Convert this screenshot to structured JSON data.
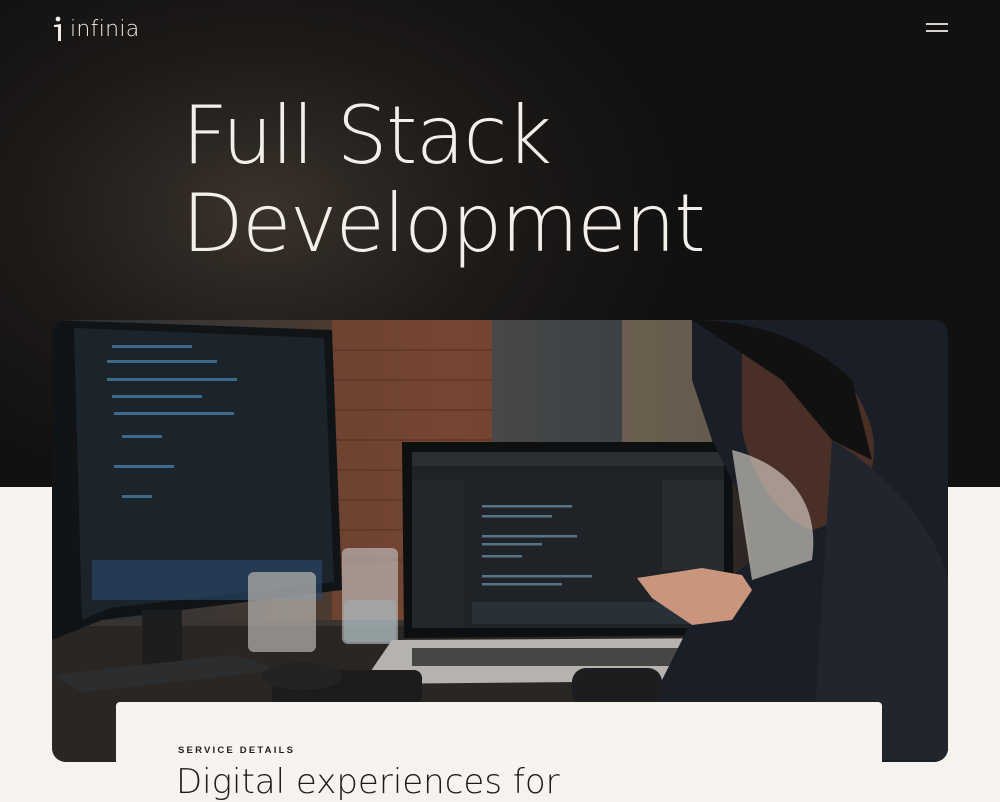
{
  "header": {
    "logo_text": "infinia",
    "menu_icon": "hamburger-menu-icon"
  },
  "hero": {
    "title_line_1": "Full Stack",
    "title_line_2": "Development"
  },
  "photo": {
    "alt": "developer-at-desk-photo"
  },
  "service": {
    "eyebrow": "SERVICE DETAILS",
    "title": "Digital experiences for"
  },
  "colors": {
    "hero_bg": "#121111",
    "page_bg": "#f6f2ed",
    "hero_text": "#f3efea",
    "card_bg": "#f7f3ee"
  }
}
